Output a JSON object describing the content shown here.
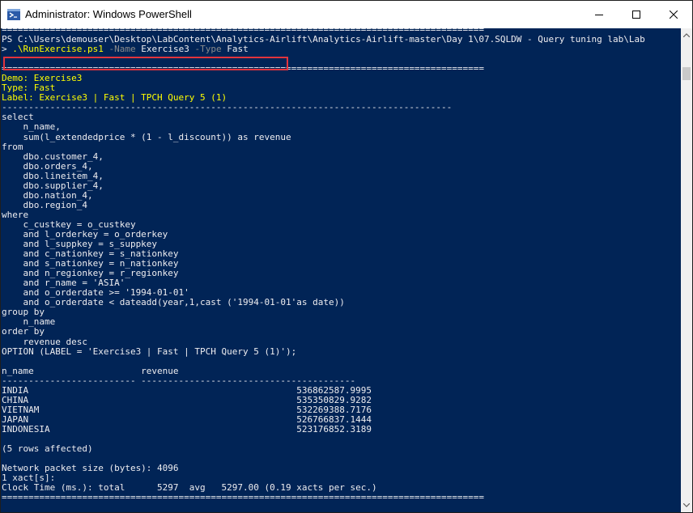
{
  "window": {
    "title": "Administrator: Windows PowerShell",
    "icons": {
      "app": "powershell-icon",
      "minimize": "minimize-icon",
      "maximize": "maximize-icon",
      "close": "close-icon"
    }
  },
  "console": {
    "bg_color": "#012456",
    "rule": "==========================================================================================",
    "prompt_line": "PS C:\\Users\\demouser\\Desktop\\LabContent\\Analytics-Airlift\\Analytics-Airlift-master\\Day 1\\07.SQLDW - Query tuning lab\\Lab",
    "command": {
      "prompt": "> ",
      "script": ".\\RunExercise.ps1",
      "param1": "-Name",
      "arg1": "Exercise3",
      "param2": "-Type",
      "arg2": "Fast"
    },
    "demo_line": "Demo: Exercise3",
    "type_line": "Type: Fast",
    "label_line": "Label: Exercise3 | Fast | TPCH Query 5 (1)",
    "dash_rule": "------------------------------------------------------------------------------------",
    "sql": [
      "select",
      "    n_name,",
      "    sum(l_extendedprice * (1 - l_discount)) as revenue",
      "from",
      "    dbo.customer_4,",
      "    dbo.orders_4,",
      "    dbo.lineitem_4,",
      "    dbo.supplier_4,",
      "    dbo.nation_4,",
      "    dbo.region_4",
      "where",
      "    c_custkey = o_custkey",
      "    and l_orderkey = o_orderkey",
      "    and l_suppkey = s_suppkey",
      "    and c_nationkey = s_nationkey",
      "    and s_nationkey = n_nationkey",
      "    and n_regionkey = r_regionkey",
      "    and r_name = 'ASIA'",
      "    and o_orderdate >= '1994-01-01'",
      "    and o_orderdate < dateadd(year,1,cast ('1994-01-01'as date))",
      "group by",
      "    n_name",
      "order by",
      "    revenue desc",
      "OPTION (LABEL = 'Exercise3 | Fast | TPCH Query 5 (1)');"
    ],
    "results": {
      "header": "n_name                    revenue",
      "separator": "------------------------- ----------------------------------------",
      "rows": [
        "INDIA                                                  536862587.9995",
        "CHINA                                                  535350829.9282",
        "VIETNAM                                                532269388.7176",
        "JAPAN                                                  526766837.1444",
        "INDONESIA                                              523176852.3189"
      ],
      "affected": "(5 rows affected)"
    },
    "stats": [
      "Network packet size (bytes): 4096",
      "1 xact[s]:",
      "Clock Time (ms.): total      5297  avg   5297.00 (0.19 xacts per sec.)"
    ],
    "bottom_rule": "==========================================================================================",
    "highlight_color": "#e2343d"
  }
}
